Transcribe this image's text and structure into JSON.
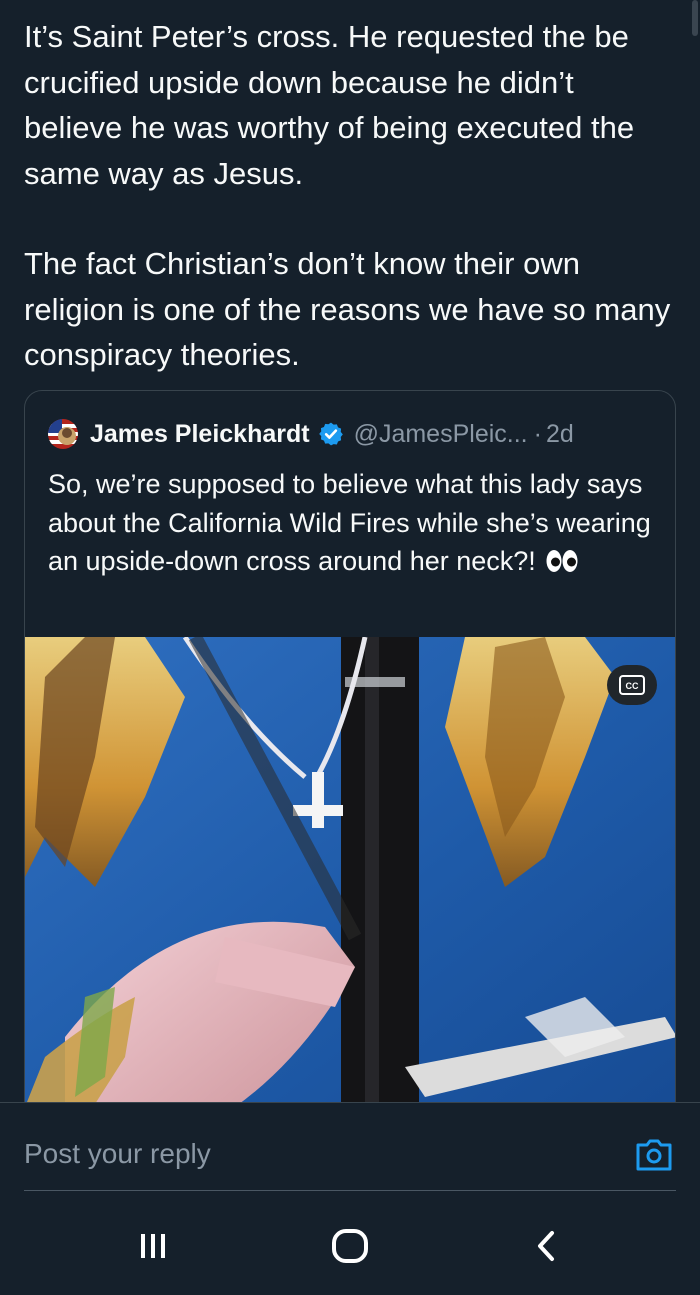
{
  "post": {
    "paragraphs": [
      "It’s Saint Peter’s cross. He requested the be crucified upside down because he didn’t believe he was worthy of being executed the same way as Jesus.",
      "The fact Christian’s don’t know their own religion is one of the reasons we have so many conspiracy theories."
    ]
  },
  "quote": {
    "author_name": "James Pleickhardt",
    "handle": "@JamesPleic...",
    "separator": "·",
    "age": "2d",
    "text": "So, we’re supposed to believe what this lady says about the California Wild Fires while she’s wearing an upside-down cross around her neck?!",
    "emoji_icon": "eyes-emoji",
    "media": {
      "caption_badge": "CC",
      "accent_colors": [
        "#1f5aa8",
        "#e3b04a",
        "#1a1a1a"
      ]
    }
  },
  "reply": {
    "placeholder": "Post your reply",
    "camera_icon": "camera-icon"
  },
  "android_nav": {
    "recents_icon": "recents-icon",
    "home_icon": "home-icon",
    "back_icon": "back-icon"
  },
  "colors": {
    "background": "#15202b",
    "text_primary": "#f7f9f9",
    "text_secondary": "#8b98a5",
    "accent": "#1d9bf0",
    "border": "#38444d"
  }
}
